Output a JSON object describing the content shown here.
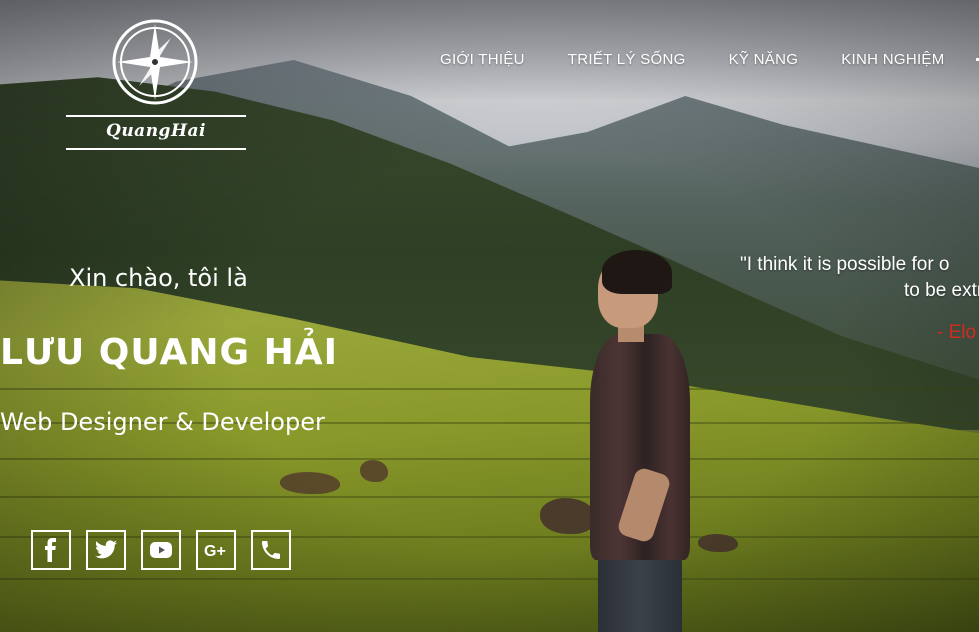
{
  "logo": {
    "text": "QuangHai"
  },
  "nav": {
    "items": [
      "GIỚI THIỆU",
      "TRIẾT LÝ SỐNG",
      "KỸ NĂNG",
      "KINH NGHIỆM"
    ]
  },
  "intro": {
    "greeting": "Xin chào, tôi là",
    "name": "LƯU QUANG HẢI",
    "role": "Web Designer & Developer"
  },
  "quote": {
    "line1": "\"I think it is possible for o",
    "line2": "to be extra",
    "author": "- Elo",
    "author_color": "#d12a1f"
  },
  "social": [
    {
      "icon": "facebook-icon"
    },
    {
      "icon": "twitter-icon"
    },
    {
      "icon": "youtube-icon"
    },
    {
      "icon": "google-plus-icon"
    },
    {
      "icon": "phone-icon"
    }
  ]
}
